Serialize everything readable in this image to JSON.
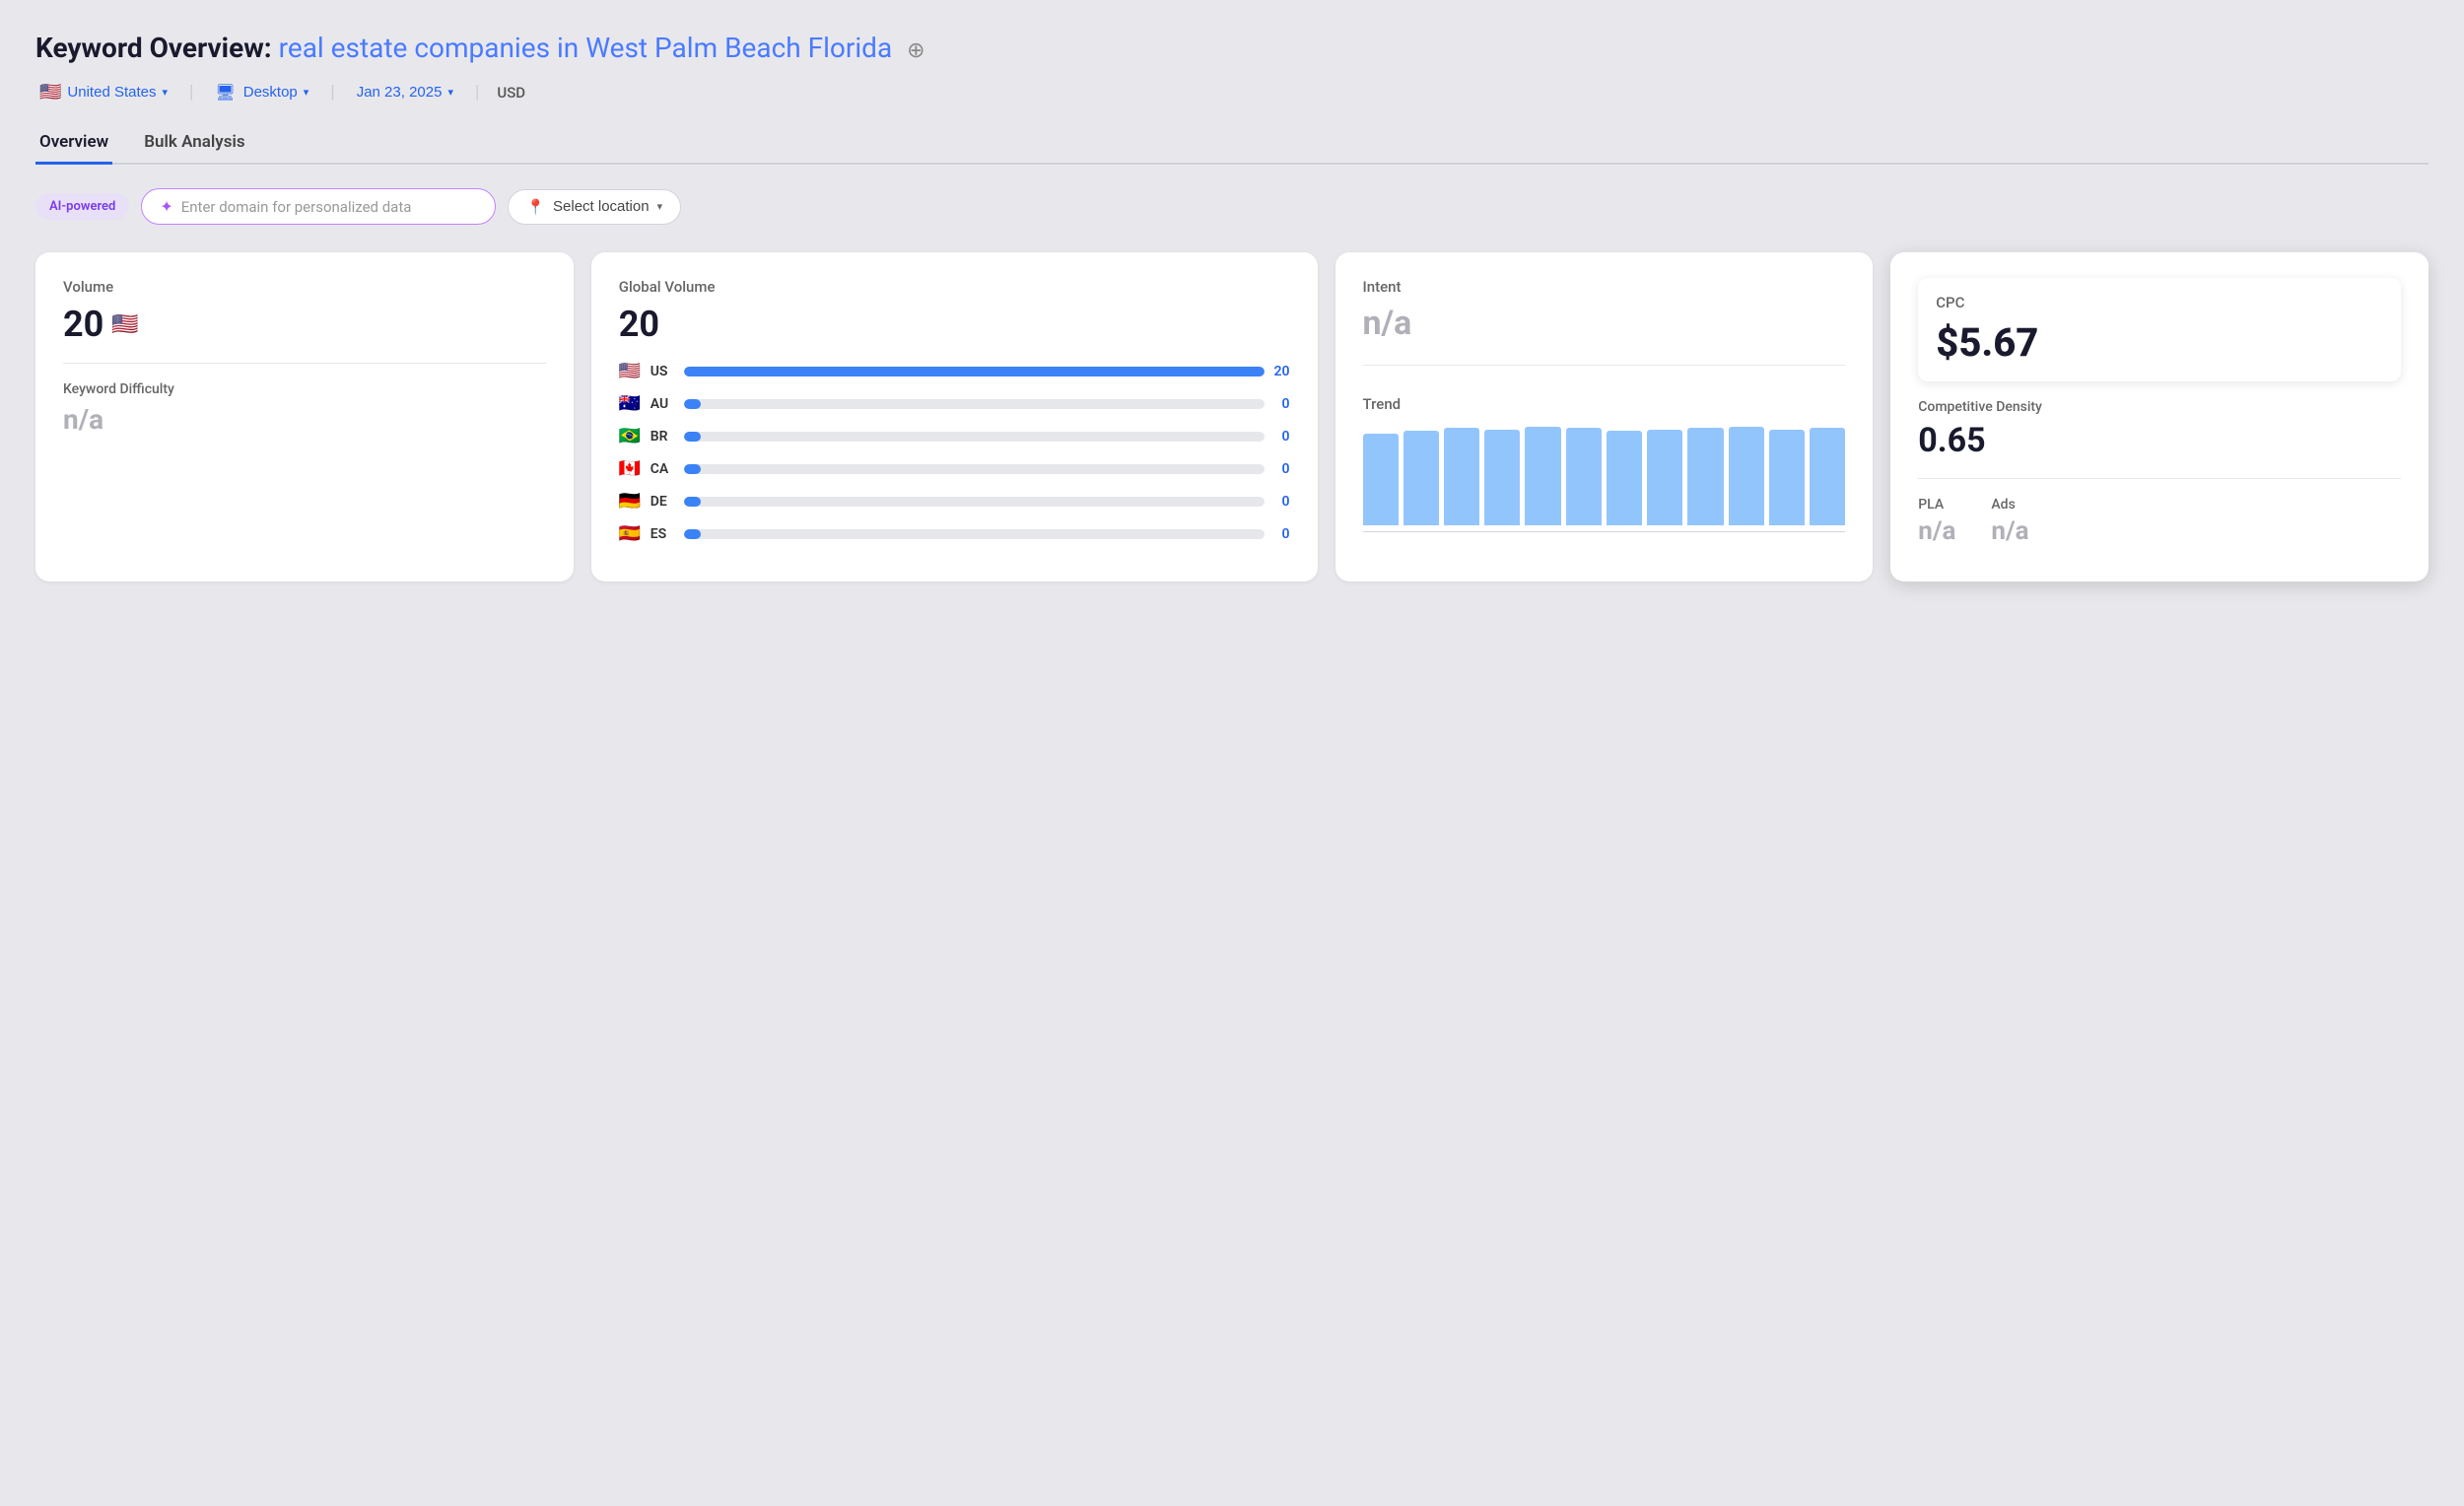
{
  "header": {
    "title_prefix": "Keyword Overview:",
    "title_keyword": "real estate companies in West Palm Beach Florida",
    "add_icon": "⊕"
  },
  "filters": {
    "location": {
      "flag": "🇺🇸",
      "label": "United States",
      "chevron": "▾"
    },
    "device": {
      "label": "Desktop",
      "chevron": "▾"
    },
    "date": {
      "label": "Jan 23, 2025",
      "chevron": "▾"
    },
    "currency": "USD"
  },
  "tabs": [
    {
      "label": "Overview",
      "active": true
    },
    {
      "label": "Bulk Analysis",
      "active": false
    }
  ],
  "ai_section": {
    "badge": "AI-powered",
    "input_placeholder": "Enter domain for personalized data",
    "location_select": "Select location"
  },
  "cards": {
    "volume": {
      "label": "Volume",
      "value": "20",
      "sub_label": "Keyword Difficulty",
      "sub_value": "n/a"
    },
    "global_volume": {
      "label": "Global Volume",
      "value": "20",
      "countries": [
        {
          "flag": "🇺🇸",
          "code": "US",
          "bar_pct": 100,
          "val": "20"
        },
        {
          "flag": "🇦🇺",
          "code": "AU",
          "bar_pct": 3,
          "val": "0"
        },
        {
          "flag": "🇧🇷",
          "code": "BR",
          "bar_pct": 3,
          "val": "0"
        },
        {
          "flag": "🇨🇦",
          "code": "CA",
          "bar_pct": 3,
          "val": "0"
        },
        {
          "flag": "🇩🇪",
          "code": "DE",
          "bar_pct": 3,
          "val": "0"
        },
        {
          "flag": "🇪🇸",
          "code": "ES",
          "bar_pct": 3,
          "val": "0"
        }
      ]
    },
    "intent": {
      "label": "Intent",
      "value": "n/a"
    },
    "trend": {
      "label": "Trend",
      "bars": [
        70,
        72,
        74,
        73,
        75,
        74,
        72,
        73,
        74,
        75,
        73,
        74
      ]
    },
    "cpc": {
      "label": "CPC",
      "value": "$5.67"
    },
    "competitive_density": {
      "label": "Competitive Density",
      "value": "0.65"
    },
    "pla": {
      "label": "PLA",
      "value": "n/a"
    },
    "ads": {
      "label": "Ads",
      "value": "n/a"
    }
  }
}
